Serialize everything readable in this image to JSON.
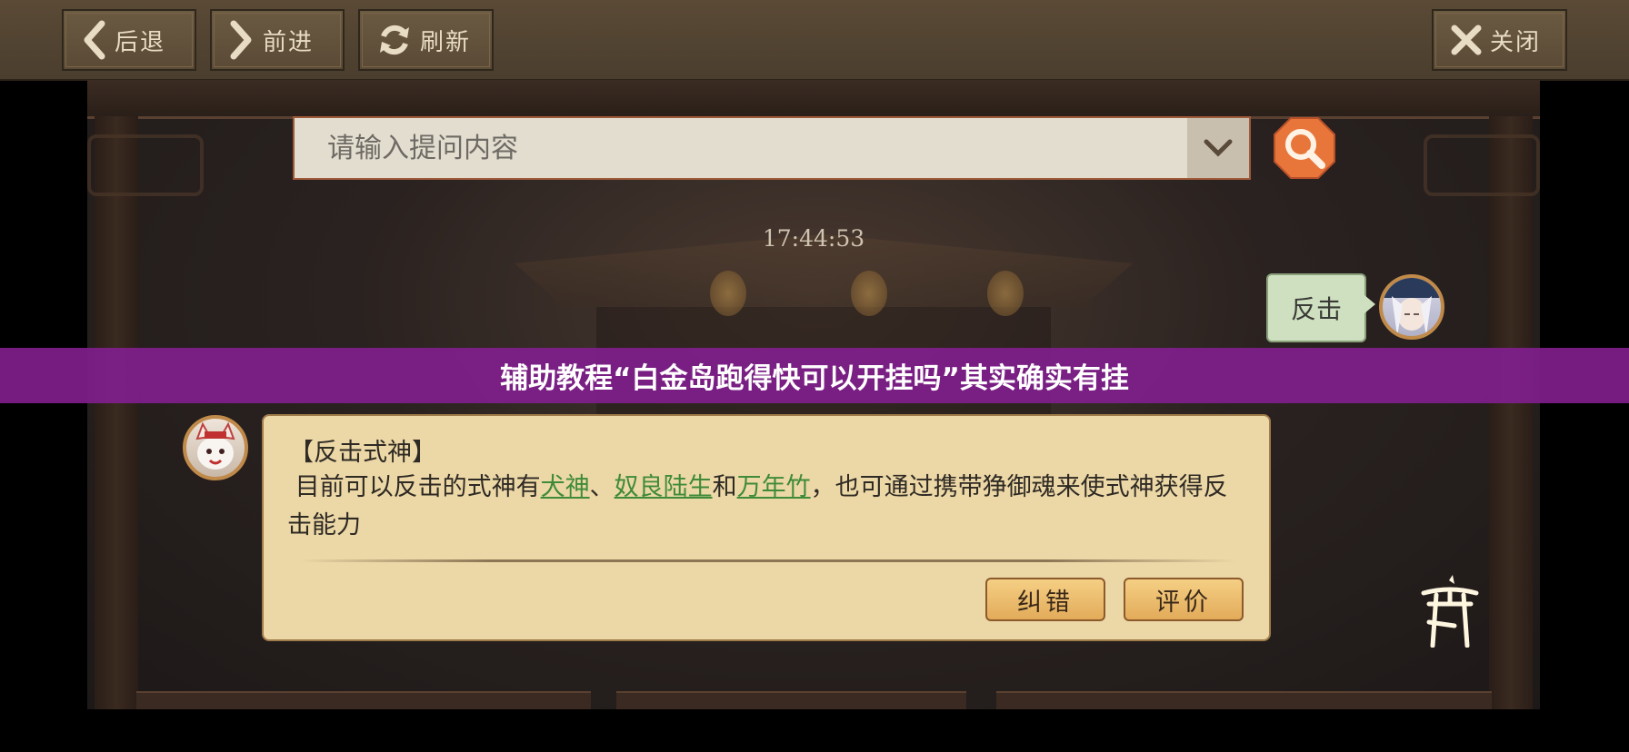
{
  "toolbar": {
    "back_label": "后退",
    "forward_label": "前进",
    "refresh_label": "刷新",
    "close_label": "关闭"
  },
  "search": {
    "placeholder": "请输入提问内容",
    "value": ""
  },
  "chat": {
    "timestamp": "17:44:53",
    "user_message": "反击",
    "bot_title": "【反击式神】",
    "bot_text_prefix": "目前可以反击的式神有",
    "link_1": "犬神",
    "sep_1": "、",
    "link_2": "奴良陆生",
    "sep_2": "和",
    "link_3": "万年竹",
    "bot_text_suffix": "，也可通过携带狰御魂来使式神获得反击能力",
    "correct_label": "纠错",
    "rate_label": "评价"
  },
  "banner": {
    "text": "辅助教程“白金岛跑得快可以开挂吗”其实确实有挂"
  },
  "icons": {
    "back": "chevron-left-icon",
    "forward": "chevron-right-icon",
    "refresh": "refresh-icon",
    "close": "close-icon",
    "dropdown": "chevron-down-icon",
    "search": "search-icon",
    "torii": "torii-gate-icon"
  },
  "colors": {
    "toolbar_bg": "#5a4a36",
    "card_bg": "#ecd7a6",
    "user_bubble": "#cfe0c0",
    "link": "#3f8b3a",
    "search_button": "#e8763a",
    "banner": "#801e8c"
  }
}
